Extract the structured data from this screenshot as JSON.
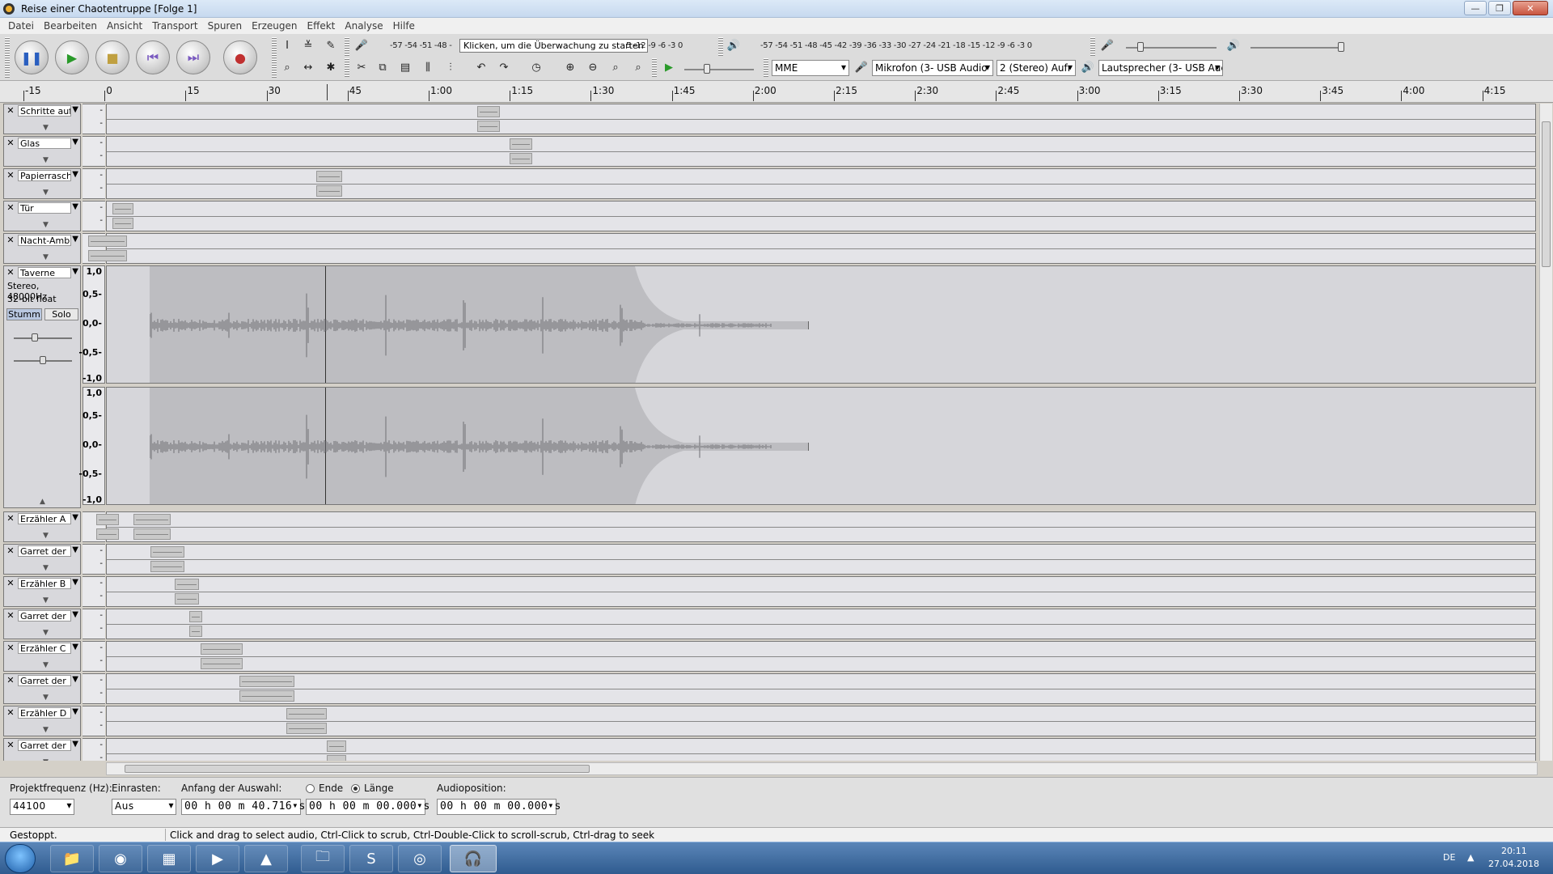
{
  "window": {
    "title": "Reise einer Chaotentruppe [Folge 1]",
    "min": "—",
    "max": "❐",
    "close": "✕"
  },
  "menu": [
    "Datei",
    "Bearbeiten",
    "Ansicht",
    "Transport",
    "Spuren",
    "Erzeugen",
    "Effekt",
    "Analyse",
    "Hilfe"
  ],
  "meters": {
    "rec_scale": "-57 -54 -51 -48 -",
    "rec_tooltip": "Klicken, um die Überwachung zu starten",
    "rec_scale_right": "5 -12 -9 -6 -3 0",
    "play_scale": "-57 -54 -51 -48 -45 -42 -39 -36 -33 -30 -27 -24 -21 -18 -15 -12 -9 -6 -3 0"
  },
  "devices": {
    "host": "MME",
    "input": "Mikrofon (3- USB Audio",
    "channels": "2 (Stereo) Aufr",
    "output": "Lautsprecher (3- USB Auc"
  },
  "ruler": [
    "-15",
    "0",
    "15",
    "30",
    "45",
    "1:00",
    "1:15",
    "1:30",
    "1:45",
    "2:00",
    "2:15",
    "2:30",
    "2:45",
    "3:00",
    "3:15",
    "3:30",
    "3:45",
    "4:00",
    "4:15"
  ],
  "tracks": [
    {
      "name": "Schritte auf"
    },
    {
      "name": "Glas"
    },
    {
      "name": "Papierrasch"
    },
    {
      "name": "Tür"
    },
    {
      "name": "Nacht-Ambi"
    },
    {
      "name": "Erzähler A"
    },
    {
      "name": "Garret der"
    },
    {
      "name": "Erzähler B"
    },
    {
      "name": "Garret der"
    },
    {
      "name": "Erzähler C"
    },
    {
      "name": "Garret der"
    },
    {
      "name": "Erzähler D"
    },
    {
      "name": "Garret der"
    }
  ],
  "taverne": {
    "name": "Taverne",
    "info1": "Stereo, 48000Hz",
    "info2": "32-bit float",
    "mute": "Stumm",
    "solo": "Solo",
    "scale": [
      "1,0",
      "0,5-",
      "0,0-",
      "-0,5-",
      "-1,0"
    ]
  },
  "selection": {
    "rate_label": "Projektfrequenz (Hz):",
    "rate_value": "44100",
    "snap_label": "Einrasten:",
    "snap_value": "Aus",
    "start_label": "Anfang der Auswahl:",
    "end_label": "Ende",
    "length_label": "Länge",
    "start_value": "00 h 00 m 40.716 s",
    "length_value": "00 h 00 m 00.000 s",
    "audiopos_label": "Audioposition:",
    "audiopos_value": "00 h 00 m 00.000 s"
  },
  "status": {
    "state": "Gestoppt.",
    "hint": "Click and drag to select audio, Ctrl-Click to scrub, Ctrl-Double-Click to scroll-scrub, Ctrl-drag to seek"
  },
  "taskbar": {
    "lang": "DE",
    "time": "20:11",
    "date": "27.04.2018"
  }
}
